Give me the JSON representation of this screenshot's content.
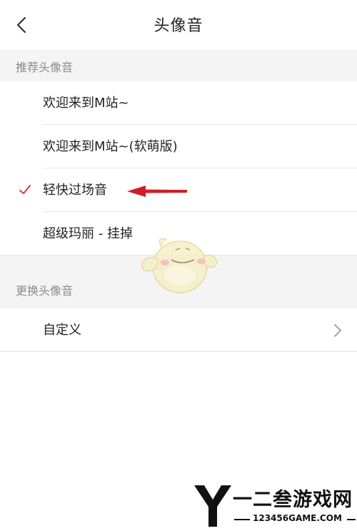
{
  "header": {
    "title": "头像音",
    "back_icon": "chevron-left-icon"
  },
  "recommended": {
    "section_title": "推荐头像音",
    "items": [
      {
        "label": "欢迎来到M站~",
        "selected": false
      },
      {
        "label": "欢迎来到M站~(软萌版)",
        "selected": false
      },
      {
        "label": "轻快过场音",
        "selected": true
      },
      {
        "label": "超级玛丽 - 挂掉",
        "selected": false
      }
    ]
  },
  "change": {
    "section_title": "更换头像音",
    "custom_label": "自定义",
    "chevron_icon": "chevron-right-icon"
  },
  "colors": {
    "accent_red": "#d0303a",
    "annotation_red": "#cc1f27",
    "section_bg": "#f4f4f4",
    "section_text": "#8a8a8a",
    "divider": "#e6e6e6"
  },
  "watermark": {
    "title": "一二叁游戏网",
    "url": "123456GAME.COM"
  }
}
